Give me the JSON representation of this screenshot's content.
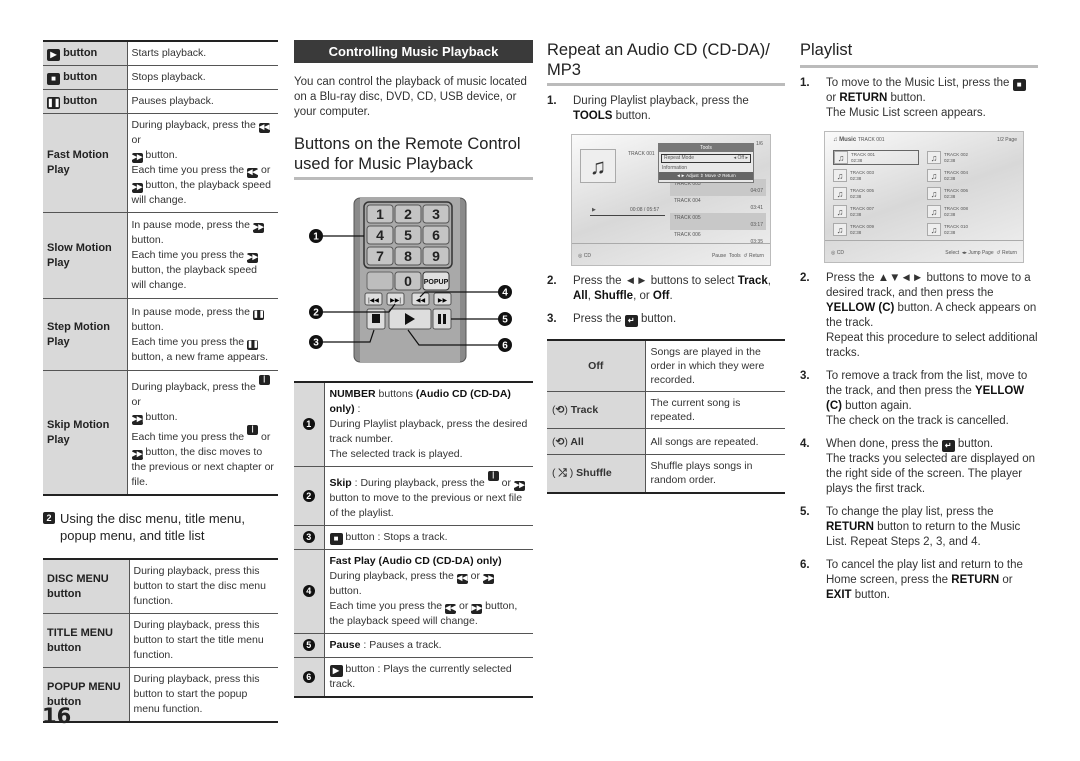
{
  "col1": {
    "table1": [
      {
        "icon": "play-icon",
        "label": "button",
        "desc": "Starts playback."
      },
      {
        "icon": "stop-icon",
        "label": "button",
        "desc": "Stops playback."
      },
      {
        "icon": "pause-icon",
        "label": "button",
        "desc": "Pauses playback."
      },
      {
        "label": "Fast Motion Play",
        "desc_parts": [
          "During playback, press the",
          "or",
          "button.",
          "Each time you press the",
          "or",
          "button, the playback speed will change."
        ]
      },
      {
        "label": "Slow Motion Play",
        "desc_parts": [
          "In pause mode, press the",
          "button.",
          "Each time you press the",
          "button, the playback speed will change."
        ]
      },
      {
        "label": "Step Motion Play",
        "desc_parts": [
          "In pause mode, press the",
          "button.",
          "Each time you press the",
          "button, a new frame appears."
        ]
      },
      {
        "label": "Skip Motion Play",
        "desc_parts": [
          "During playback, press the",
          "or",
          "button.",
          "Each time you press the",
          "or",
          "button, the disc moves to the previous or next chapter or file."
        ]
      }
    ],
    "section2": {
      "num": "2",
      "title": "Using the disc menu, title menu, popup menu, and title list"
    },
    "table2": [
      {
        "label": "DISC MENU button",
        "desc": "During playback, press this button to start the disc menu function."
      },
      {
        "label": "TITLE MENU button",
        "desc": "During playback, press this button to start the title menu function."
      },
      {
        "label": "POPUP MENU button",
        "desc": "During playback, press this button to start the popup menu function."
      }
    ]
  },
  "col2": {
    "banner": "Controlling Music Playback",
    "intro": "You can control the playback of music located on a Blu-ray disc, DVD, CD, USB device, or your computer.",
    "heading": "Buttons on the Remote Control used for Music Playback",
    "remote": {
      "keys": [
        "1",
        "2",
        "3",
        "4",
        "5",
        "6",
        "7",
        "8",
        "9",
        "0"
      ],
      "popup": "POPUP",
      "callouts": [
        "1",
        "2",
        "3",
        "4",
        "5",
        "6"
      ]
    },
    "table": [
      {
        "n": "1",
        "bold": "NUMBER",
        "t1": " buttons ",
        "bold2": "(Audio CD (CD-DA) only)",
        "t2": " :",
        "lines": [
          "During Playlist playback, press the desired track number.",
          "The selected track is played."
        ]
      },
      {
        "n": "2",
        "bold": "Skip",
        "t1": " : During playback, press the",
        "or": "or",
        "t2": "button to move to the previous or next file of the playlist."
      },
      {
        "n": "3",
        "t1": "button : Stops a track."
      },
      {
        "n": "4",
        "bold": "Fast Play (Audio CD (CD-DA) only)",
        "p1": "During playback, press the",
        "or": "or",
        "p2": "button.",
        "p3": "Each time you press the",
        "p4": "button,",
        "p5": "the playback speed will change."
      },
      {
        "n": "5",
        "bold": "Pause",
        "t1": " : Pauses a track."
      },
      {
        "n": "6",
        "t1": "button : Plays the currently selected track."
      }
    ]
  },
  "col3": {
    "heading": "Repeat an Audio CD (CD-DA)/ MP3",
    "step1": {
      "num": "1.",
      "pre": "During Playlist playback, press the ",
      "bold": "TOOLS",
      "post": " button."
    },
    "screen": {
      "track_now": "TRACK 001",
      "time": "00:08 / 05:57",
      "tools_title": "Tools",
      "repeat_label": "Repeat Mode",
      "repeat_value": "Off",
      "information": "Information",
      "nav": "◄► Adjust  ⇕ Move  ↺ Return",
      "tracks": [
        {
          "name": "TRACK 003",
          "time": "04:07"
        },
        {
          "name": "TRACK 004",
          "time": "03:41"
        },
        {
          "name": "TRACK 005",
          "time": "03:17"
        },
        {
          "name": "TRACK 006",
          "time": "03:35"
        }
      ],
      "page": "1/6",
      "source": "CD",
      "footer": [
        "Pause",
        "Tools",
        "Return"
      ]
    },
    "step2": {
      "num": "2.",
      "pre": "Press the ◄► buttons to select ",
      "b1": "Track",
      "b2": "All",
      "b3": "Shuffle",
      "b4": "Off",
      "sep1": ", ",
      "sep2": ", ",
      "sep3": ", or ",
      "end": "."
    },
    "step3": {
      "num": "3.",
      "pre": "Press the",
      "post": "button."
    },
    "table": [
      {
        "label": "Off",
        "desc": "Songs are played in the order in which they were recorded."
      },
      {
        "icon": "repeat-track-icon",
        "label": "Track",
        "desc": "The current song is repeated."
      },
      {
        "icon": "repeat-all-icon",
        "label": "All",
        "desc": "All songs are repeated."
      },
      {
        "icon": "shuffle-icon",
        "label": "Shuffle",
        "desc": "Shuffle plays songs in random order."
      }
    ]
  },
  "col4": {
    "heading": "Playlist",
    "step1": {
      "num": "1.",
      "pre": "To move to the Music List, press the",
      "mid": "or ",
      "bold": "RETURN",
      "post": " button.",
      "line2": "The Music List screen appears."
    },
    "screen": {
      "title": "Music",
      "track_now": "TRACK 001",
      "page": "1/2 Page",
      "tracks": [
        {
          "name": "TRACK 001",
          "time": "02:38"
        },
        {
          "name": "TRACK 002",
          "time": "02:38"
        },
        {
          "name": "TRACK 003",
          "time": "02:38"
        },
        {
          "name": "TRACK 004",
          "time": "02:38"
        },
        {
          "name": "TRACK 005",
          "time": "02:38"
        },
        {
          "name": "TRACK 006",
          "time": "02:38"
        },
        {
          "name": "TRACK 007",
          "time": "02:38"
        },
        {
          "name": "TRACK 008",
          "time": "02:38"
        },
        {
          "name": "TRACK 009",
          "time": "02:38"
        },
        {
          "name": "TRACK 010",
          "time": "02:38"
        }
      ],
      "source": "CD",
      "footer": [
        "Select",
        "Jump Page",
        "Return"
      ]
    },
    "steps": [
      {
        "num": "2.",
        "html_parts": [
          "Press the ▲▼◄► buttons to move to a desired track, and then press the ",
          "YELLOW (C)",
          " button. A check appears on the track.",
          "Repeat this procedure to select additional tracks."
        ]
      },
      {
        "num": "3.",
        "html_parts": [
          "To remove a track from the list, move to the track, and then press the ",
          "YELLOW (C)",
          " button again.",
          "The check on the track is cancelled."
        ]
      },
      {
        "num": "4.",
        "html_parts": [
          "When done, press the ",
          "",
          " button.",
          "The tracks you selected are displayed on the right side of the screen. The player plays the first track."
        ]
      },
      {
        "num": "5.",
        "html_parts": [
          "To change the play list, press the ",
          "RETURN",
          " button to return to the Music List. Repeat Steps 2, 3, and 4.",
          ""
        ]
      },
      {
        "num": "6.",
        "html_parts": [
          "To cancel the play list and return to the Home screen, press the ",
          "RETURN",
          " or ",
          "EXIT",
          " button."
        ]
      }
    ]
  },
  "page_number": "16"
}
